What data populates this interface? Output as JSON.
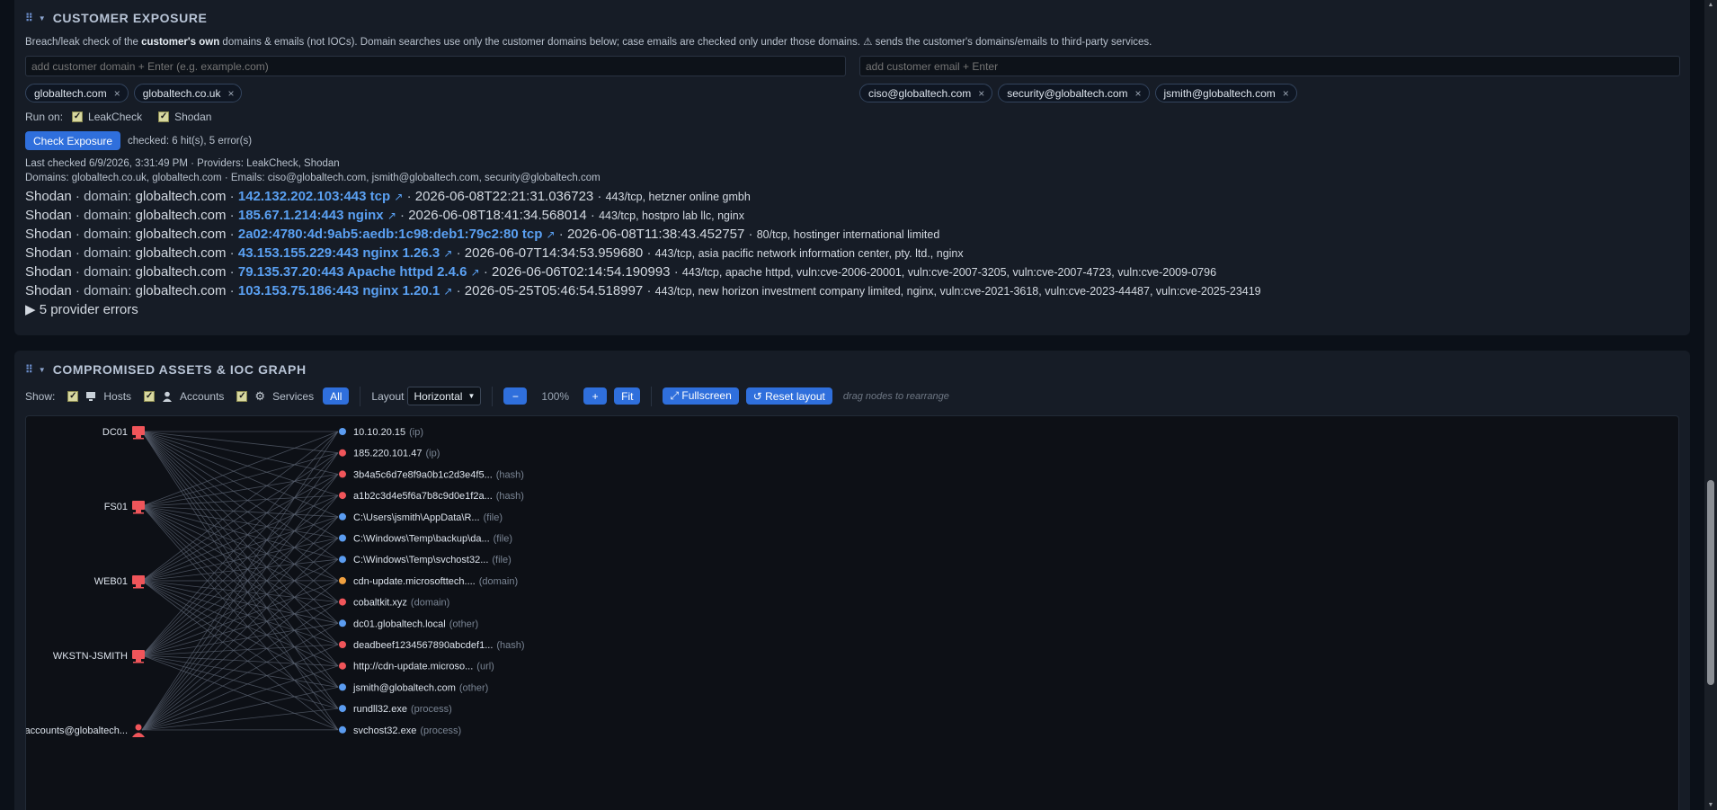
{
  "exposure": {
    "title": "CUSTOMER EXPOSURE",
    "desc_pre": "Breach/leak check of the ",
    "desc_bold": "customer's own",
    "desc_post": " domains & emails (not IOCs). Domain searches use only the customer domains below; case emails are checked only under those domains. ⚠ sends the customer's domains/emails to third-party services.",
    "domain_placeholder": "add customer domain + Enter (e.g. example.com)",
    "email_placeholder": "add customer email + Enter",
    "domains": [
      "globaltech.com",
      "globaltech.co.uk"
    ],
    "emails": [
      "ciso@globaltech.com",
      "security@globaltech.com",
      "jsmith@globaltech.com"
    ],
    "chip_remove": "×",
    "run_on_label": "Run on:",
    "providers": [
      "LeakCheck",
      "Shodan"
    ],
    "check_button": "Check Exposure",
    "status": "checked: 6 hit(s), 5 error(s)",
    "last_checked": "Last checked 6/9/2026, 3:31:49 PM · Providers: LeakCheck, Shodan",
    "scope": "Domains: globaltech.co.uk, globaltech.com · Emails: ciso@globaltech.com, jsmith@globaltech.com, security@globaltech.com",
    "results": [
      {
        "provider": "Shodan",
        "kind": "domain:",
        "domain": "globaltech.com",
        "host": "142.132.202.103:443 tcp",
        "ts": "2026-06-08T22:21:31.036723",
        "info": "443/tcp, hetzner online gmbh"
      },
      {
        "provider": "Shodan",
        "kind": "domain:",
        "domain": "globaltech.com",
        "host": "185.67.1.214:443 nginx",
        "ts": "2026-06-08T18:41:34.568014",
        "info": "443/tcp, hostpro lab llc, nginx"
      },
      {
        "provider": "Shodan",
        "kind": "domain:",
        "domain": "globaltech.com",
        "host": "2a02:4780:4d:9ab5:aedb:1c98:deb1:79c2:80 tcp",
        "ts": "2026-06-08T11:38:43.452757",
        "info": "80/tcp, hostinger international limited"
      },
      {
        "provider": "Shodan",
        "kind": "domain:",
        "domain": "globaltech.com",
        "host": "43.153.155.229:443 nginx 1.26.3",
        "ts": "2026-06-07T14:34:53.959680",
        "info": "443/tcp, asia pacific network information center, pty. ltd., nginx"
      },
      {
        "provider": "Shodan",
        "kind": "domain:",
        "domain": "globaltech.com",
        "host": "79.135.37.20:443 Apache httpd 2.4.6",
        "ts": "2026-06-06T02:14:54.190993",
        "info": "443/tcp, apache httpd, vuln:cve-2006-20001, vuln:cve-2007-3205, vuln:cve-2007-4723, vuln:cve-2009-0796"
      },
      {
        "provider": "Shodan",
        "kind": "domain:",
        "domain": "globaltech.com",
        "host": "103.153.75.186:443 nginx 1.20.1",
        "ts": "2026-05-25T05:46:54.518997",
        "info": "443/tcp, new horizon investment company limited, nginx, vuln:cve-2021-3618, vuln:cve-2023-44487, vuln:cve-2025-23419"
      }
    ],
    "errors_toggle": "▶ 5 provider errors"
  },
  "graph_panel": {
    "title": "COMPROMISED ASSETS & IOC GRAPH",
    "show_label": "Show:",
    "filters": [
      "Hosts",
      "Accounts",
      "Services"
    ],
    "all_button": "All",
    "layout_label": "Layout",
    "layout_value": "Horizontal",
    "zoom_out": "−",
    "zoom_level": "100%",
    "zoom_in": "+",
    "fit": "Fit",
    "fullscreen": "⤢ Fullscreen",
    "reset": "↺ Reset layout",
    "hint": "drag nodes to rearrange",
    "colors": {
      "red": "#f0555a",
      "blue": "#5b9cf0",
      "orange": "#f0a040",
      "edge": "#5a6270"
    },
    "left_nodes": [
      {
        "label": "DC01",
        "icon": "host-icon"
      },
      {
        "label": "FS01",
        "icon": "host-icon"
      },
      {
        "label": "WEB01",
        "icon": "host-icon"
      },
      {
        "label": "WKSTN-JSMITH",
        "icon": "host-icon"
      },
      {
        "label": "accounts@globaltech...",
        "icon": "account-icon"
      }
    ],
    "right_nodes": [
      {
        "label": "10.10.20.15",
        "type": "(ip)",
        "color": "blue"
      },
      {
        "label": "185.220.101.47",
        "type": "(ip)",
        "color": "red"
      },
      {
        "label": "3b4a5c6d7e8f9a0b1c2d3e4f5...",
        "type": "(hash)",
        "color": "red"
      },
      {
        "label": "a1b2c3d4e5f6a7b8c9d0e1f2a...",
        "type": "(hash)",
        "color": "red"
      },
      {
        "label": "C:\\Users\\jsmith\\AppData\\R...",
        "type": "(file)",
        "color": "blue"
      },
      {
        "label": "C:\\Windows\\Temp\\backup\\da...",
        "type": "(file)",
        "color": "blue"
      },
      {
        "label": "C:\\Windows\\Temp\\svchost32...",
        "type": "(file)",
        "color": "blue"
      },
      {
        "label": "cdn-update.microsofttech....",
        "type": "(domain)",
        "color": "orange"
      },
      {
        "label": "cobaltkit.xyz",
        "type": "(domain)",
        "color": "red"
      },
      {
        "label": "dc01.globaltech.local",
        "type": "(other)",
        "color": "blue"
      },
      {
        "label": "deadbeef1234567890abcdef1...",
        "type": "(hash)",
        "color": "red"
      },
      {
        "label": "http://cdn-update.microso...",
        "type": "(url)",
        "color": "red"
      },
      {
        "label": "jsmith@globaltech.com",
        "type": "(other)",
        "color": "blue"
      },
      {
        "label": "rundll32.exe",
        "type": "(process)",
        "color": "blue"
      },
      {
        "label": "svchost32.exe",
        "type": "(process)",
        "color": "blue"
      }
    ]
  }
}
